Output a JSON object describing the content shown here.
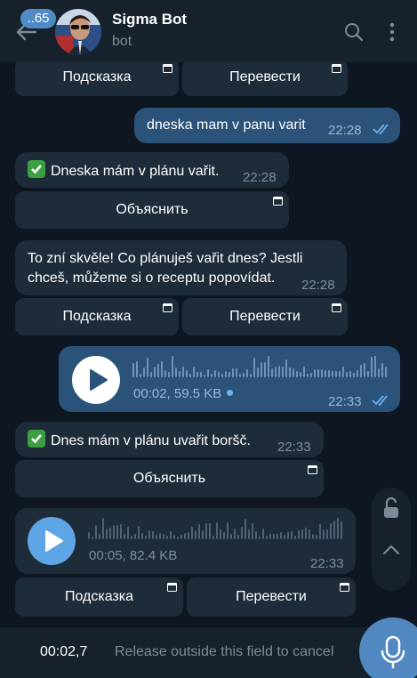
{
  "header": {
    "badge": "..65",
    "title": "Sigma Bot",
    "subtitle": "bot"
  },
  "buttons": {
    "hint": "Подсказка",
    "translate": "Перевести",
    "explain": "Объяснить"
  },
  "messages": {
    "m1_text": "dneska mam v panu varit",
    "m1_time": "22:28",
    "m2_text": "Dneska mám v plánu vařit.",
    "m2_time": "22:28",
    "m3_text": "To zní skvěle! Co plánuješ vařit dnes? Jestli chceš, můžeme si o receptu popovídat.",
    "m3_time": "22:28",
    "m4_meta": "00:02, 59.5 KB",
    "m4_time": "22:33",
    "m5_text": "Dnes mám v plánu uvařit boršč.",
    "m5_time": "22:33",
    "m6_meta": "00:05, 82.4 KB",
    "m6_time": "22:33"
  },
  "recording": {
    "time": "00:02,7",
    "hint": "Release outside this field to cancel"
  },
  "colors": {
    "background": "#0e1621",
    "header": "#17212b",
    "incoming": "#1e2c3a",
    "outgoing": "#2b5278",
    "accent": "#5288c1"
  }
}
